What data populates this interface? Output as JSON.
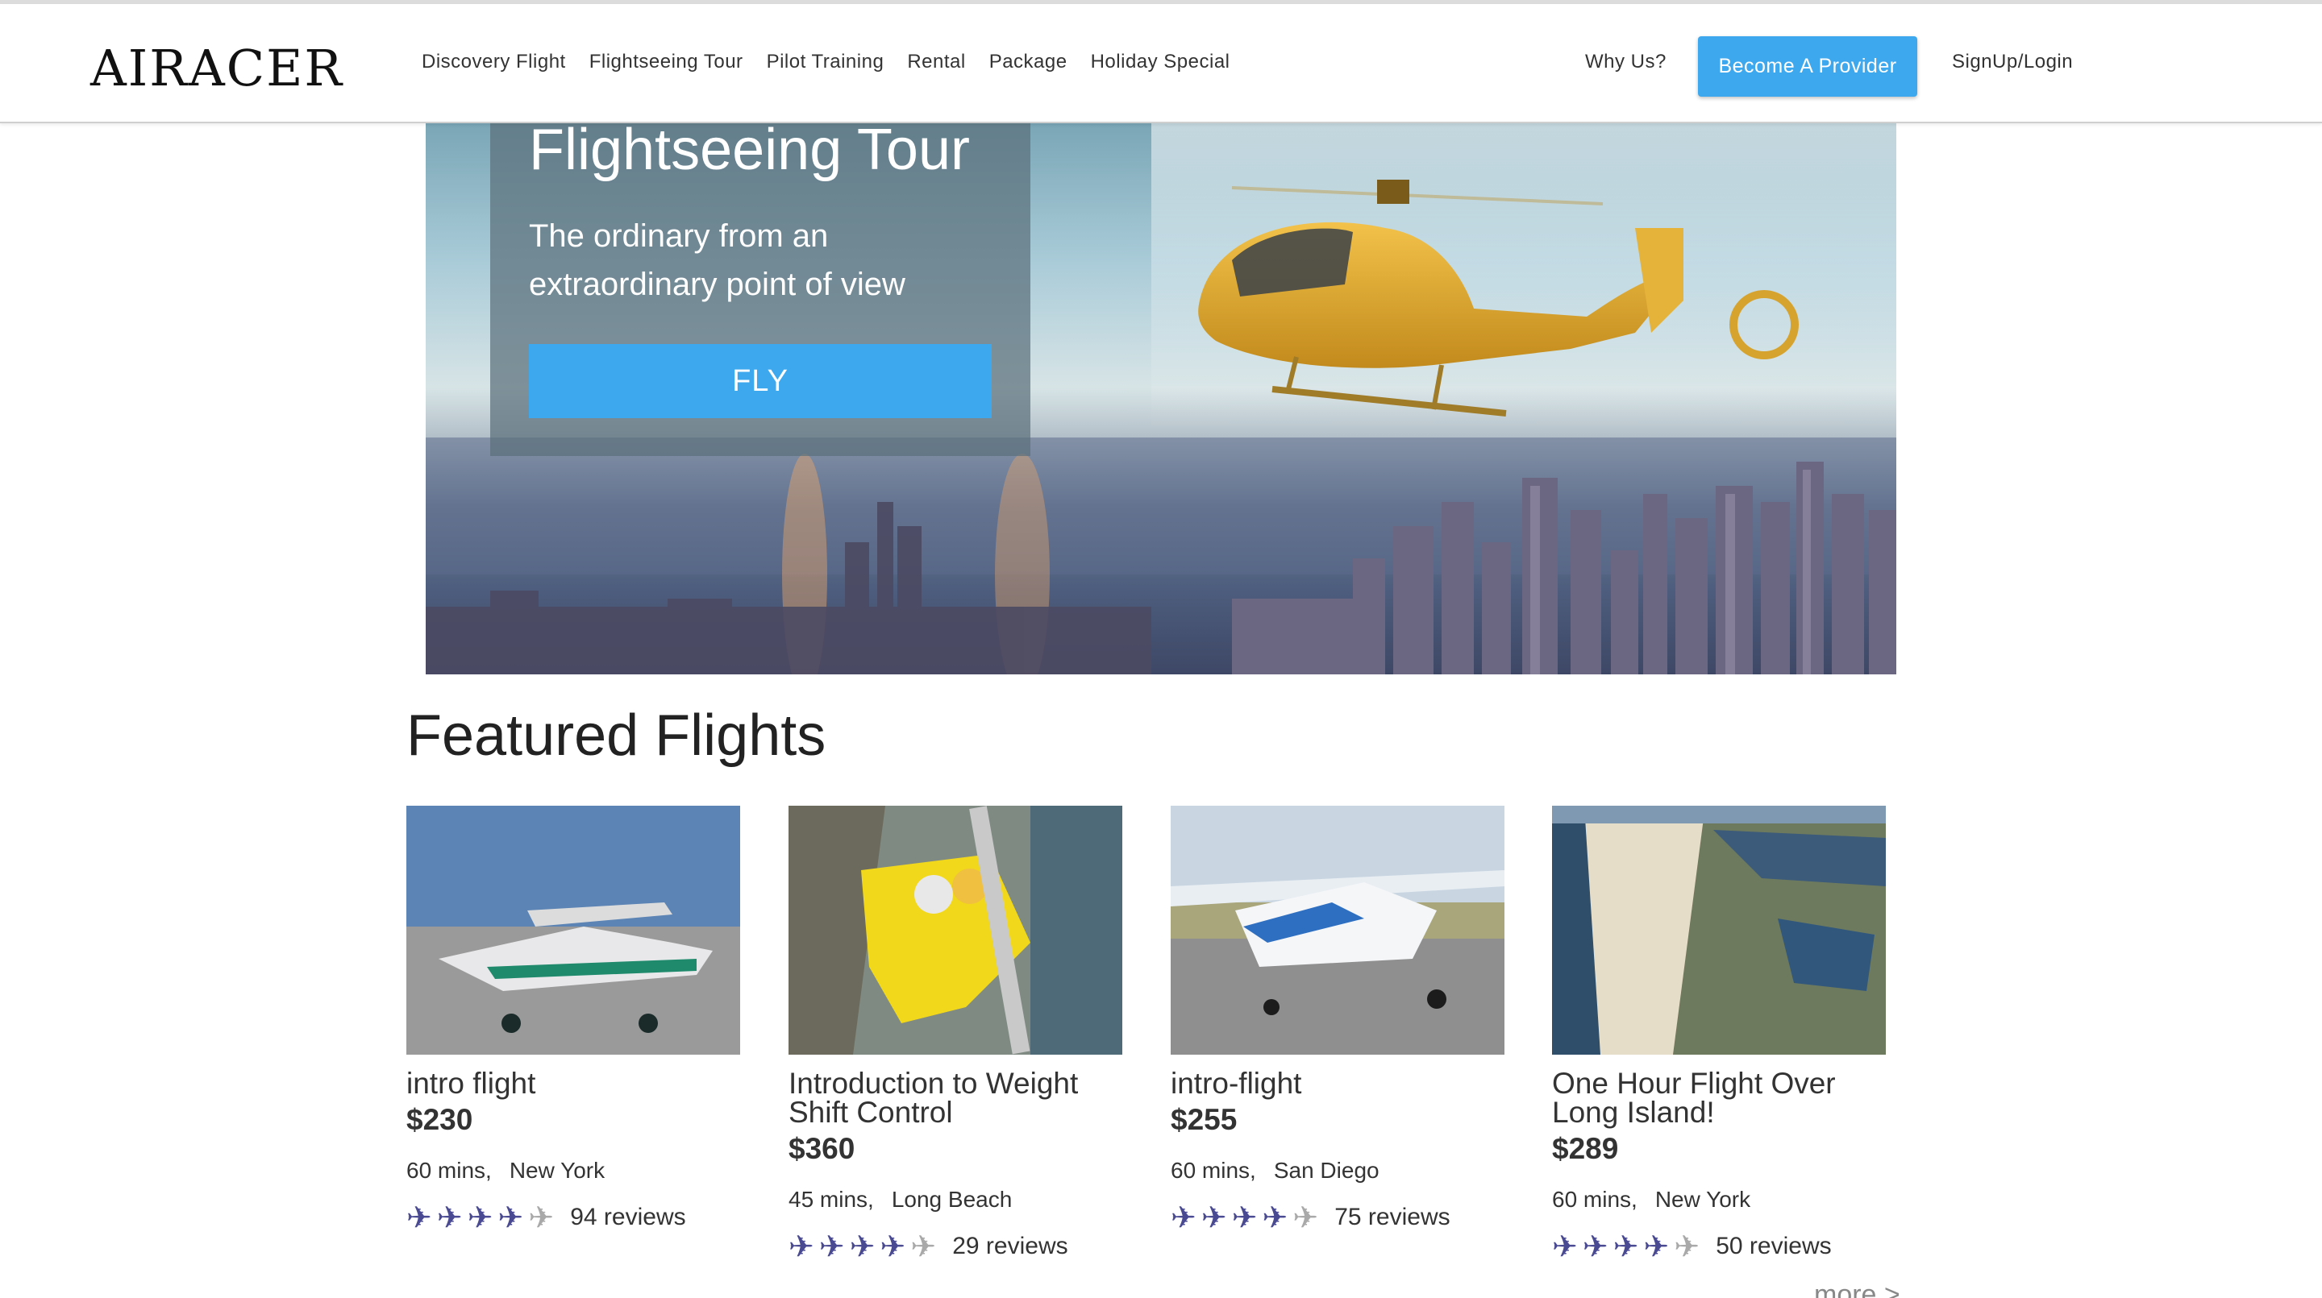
{
  "header": {
    "logo": "AIRACER",
    "nav": [
      "Discovery Flight",
      "Flightseeing Tour",
      "Pilot Training",
      "Rental",
      "Package",
      "Holiday Special"
    ],
    "why_us": "Why Us?",
    "provider_button": "Become A Provider",
    "signup": "SignUp/Login"
  },
  "hero": {
    "title": "Flightseeing Tour",
    "subtitle": "The ordinary from an extraordinary point of view",
    "cta": "FLY"
  },
  "featured": {
    "heading": "Featured Flights",
    "more": "more >",
    "cards": [
      {
        "title": "intro flight",
        "price": "$230",
        "duration": "60 mins,",
        "city": "New York",
        "rating": 4,
        "reviews": "94 reviews"
      },
      {
        "title": "Introduction to Weight Shift Control",
        "price": "$360",
        "duration": "45 mins,",
        "city": "Long Beach",
        "rating": 4,
        "reviews": "29 reviews"
      },
      {
        "title": "intro-flight",
        "price": "$255",
        "duration": "60 mins,",
        "city": "San Diego",
        "rating": 4,
        "reviews": "75 reviews"
      },
      {
        "title": "One Hour Flight Over Long Island!",
        "price": "$289",
        "duration": "60 mins,",
        "city": "New York",
        "rating": 4,
        "reviews": "50 reviews"
      }
    ]
  },
  "colors": {
    "accent": "#3ea8ee",
    "rating_on": "#4a4a93",
    "rating_off": "#a9a9a9"
  }
}
